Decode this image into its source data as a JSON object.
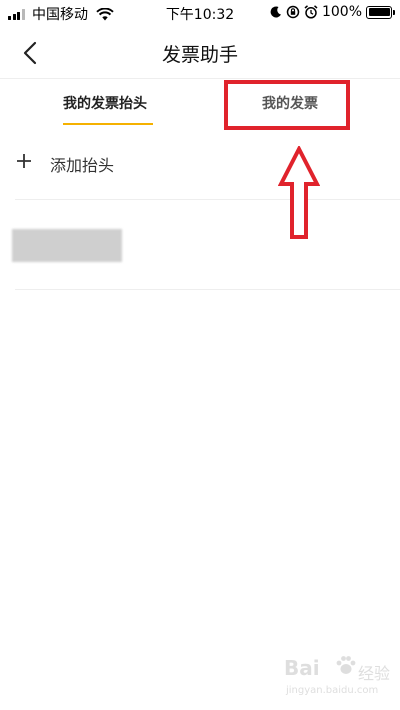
{
  "status_bar": {
    "carrier": "中国移动",
    "time": "下午10:32",
    "battery": "100%"
  },
  "nav": {
    "title": "发票助手"
  },
  "tabs": [
    {
      "label": "我的发票抬头",
      "active": true
    },
    {
      "label": "我的发票",
      "active": false
    }
  ],
  "list": {
    "add_label": "添加抬头"
  },
  "watermark": {
    "brand_left": "Bai",
    "brand_right": "经验",
    "url": "jingyan.baidu.com"
  },
  "colors": {
    "accent": "#f5b100",
    "annotation": "#e0232c"
  }
}
